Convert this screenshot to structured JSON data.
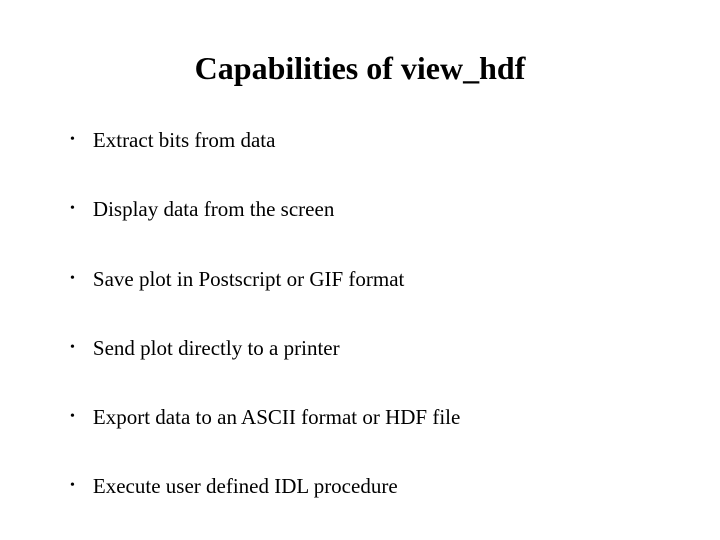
{
  "title": "Capabilities of view_hdf",
  "bullets": [
    "Extract bits from data",
    "Display data from the screen",
    "Save plot in Postscript or GIF format",
    "Send plot directly to a printer",
    "Export data to an ASCII format or HDF file",
    "Execute user defined IDL procedure"
  ]
}
